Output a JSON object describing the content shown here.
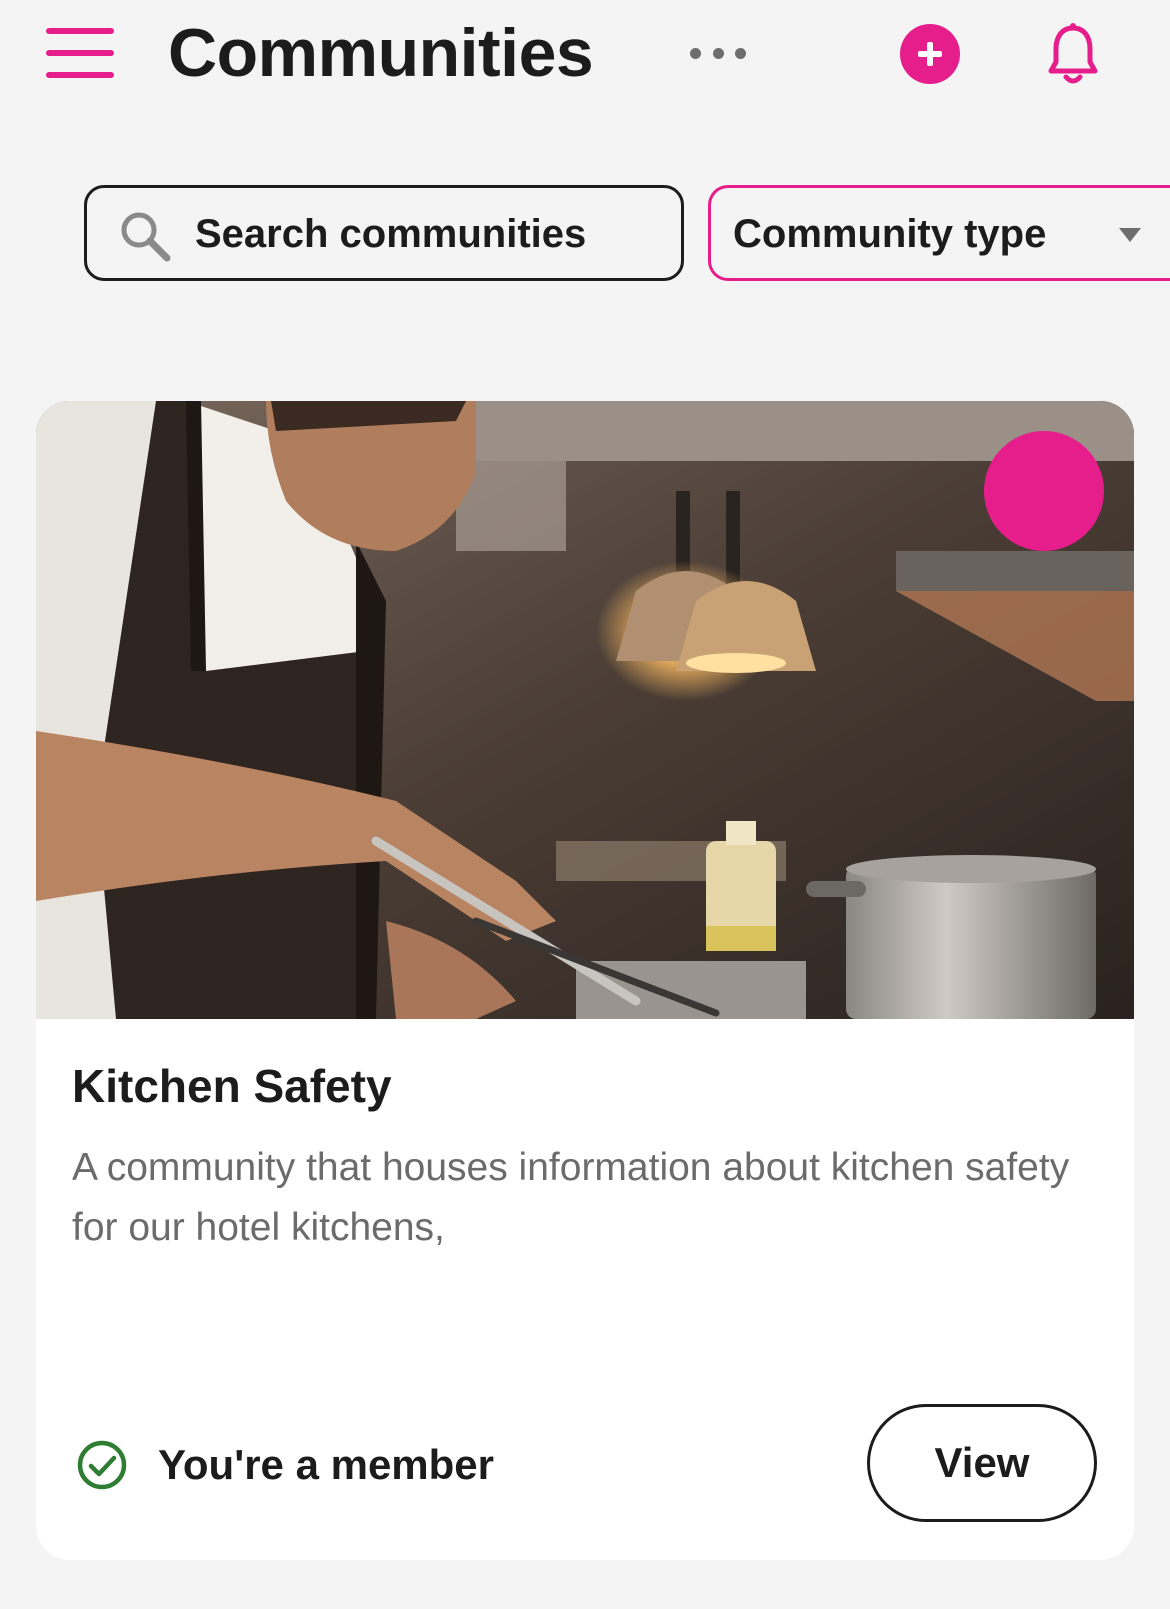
{
  "header": {
    "title": "Communities",
    "icons": {
      "menu": "hamburger-menu-icon",
      "more": "more-horizontal-icon",
      "add": "add-circle-icon",
      "notifications": "bell-icon"
    }
  },
  "filters": {
    "search": {
      "placeholder": "Search communities",
      "icon": "search-icon"
    },
    "type_select": {
      "selected": "Community type",
      "icon": "caret-down-icon"
    }
  },
  "communities": [
    {
      "title": "Kitchen Safety",
      "description": "A community that houses information about kitchen safety for our hotel kitchens,",
      "image_subject": "chef cooking in a professional kitchen",
      "badge_icon": "bookmark-check-icon",
      "membership_label": "You're a member",
      "membership_icon": "check-circle-icon",
      "action_label": "View"
    }
  ],
  "colors": {
    "accent": "#e61e8c",
    "background": "#f4f4f4",
    "card": "#ffffff",
    "text": "#1c1c1c",
    "muted_text": "#6b6b6b",
    "success": "#2e7d32"
  }
}
